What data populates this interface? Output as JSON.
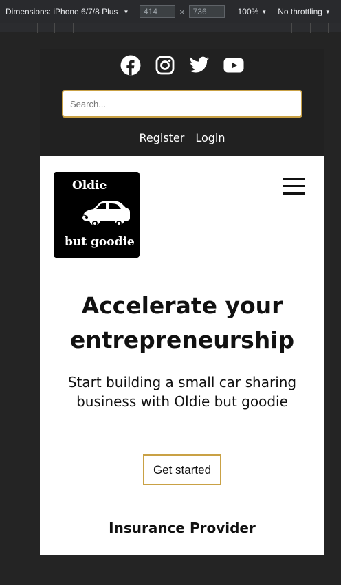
{
  "devtools": {
    "dimensions_label": "Dimensions: iPhone 6/7/8 Plus",
    "width": "414",
    "times": "×",
    "height": "736",
    "zoom": "100%",
    "throttling": "No throttling"
  },
  "header": {
    "social": [
      {
        "icon": "facebook-icon"
      },
      {
        "icon": "instagram-icon"
      },
      {
        "icon": "twitter-icon"
      },
      {
        "icon": "youtube-icon"
      }
    ],
    "search_placeholder": "Search...",
    "register_label": "Register",
    "login_label": "Login"
  },
  "brand": {
    "logo_line1": "Oldie",
    "logo_line2": "but goodie"
  },
  "hero": {
    "title": "Accelerate your entrepreneurship",
    "subtitle": "Start building a small car sharing business with Oldie but goodie",
    "cta_label": "Get started"
  },
  "section": {
    "insurance_title": "Insurance Provider"
  },
  "colors": {
    "header_bg": "#212121",
    "accent_gold": "#c9a145",
    "page_bg": "#242424"
  }
}
